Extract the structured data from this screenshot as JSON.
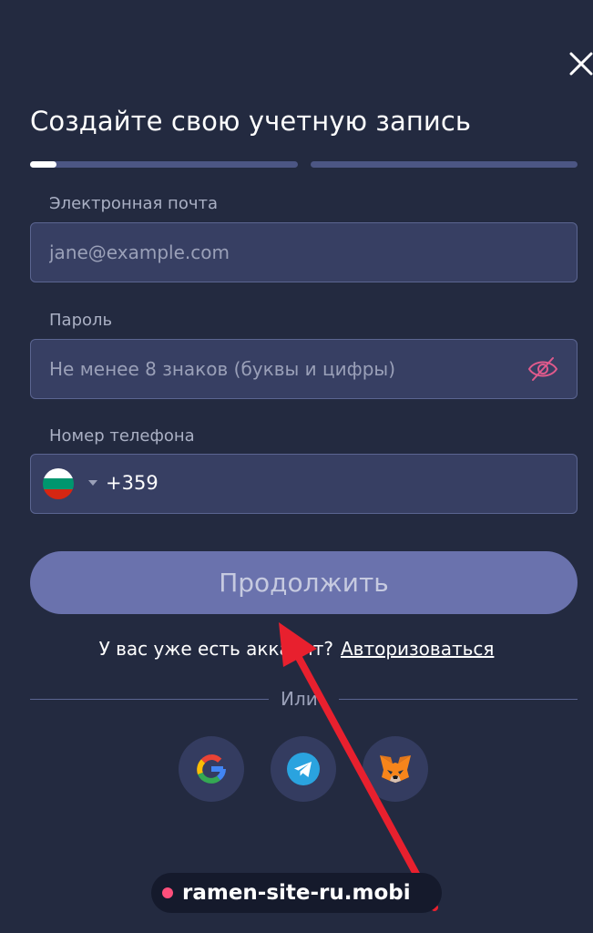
{
  "header": {
    "title": "Создайте свою учетную запись",
    "close_icon": "close-icon"
  },
  "progress": {
    "step": 1,
    "total_steps": 2,
    "step1_fill_fraction": 0.1
  },
  "form": {
    "email": {
      "label": "Электронная почта",
      "placeholder": "jane@example.com",
      "value": ""
    },
    "password": {
      "label": "Пароль",
      "placeholder": "Не менее 8 знаков (буквы и цифры)",
      "value": "",
      "toggle_icon": "eye-off-icon"
    },
    "phone": {
      "label": "Номер телефона",
      "country_flag": "bulgaria-flag-icon",
      "code": "+359"
    }
  },
  "continue_button": {
    "label": "Продолжить"
  },
  "login_prompt": {
    "text": "У вас уже есть аккаунт?",
    "link": "Авторизоваться"
  },
  "divider": {
    "text": "Или"
  },
  "social_logins": [
    {
      "name": "Google",
      "icon": "google-icon"
    },
    {
      "name": "Telegram",
      "icon": "telegram-icon"
    },
    {
      "name": "MetaMask",
      "icon": "metamask-icon"
    }
  ],
  "watermark": {
    "text": "ramen-site-ru.mobi"
  },
  "colors": {
    "background": "#232a40",
    "field_bg": "#373f63",
    "button": "#6a72ad",
    "arrow": "#e8202e",
    "eye_icon": "#e05a8c"
  }
}
